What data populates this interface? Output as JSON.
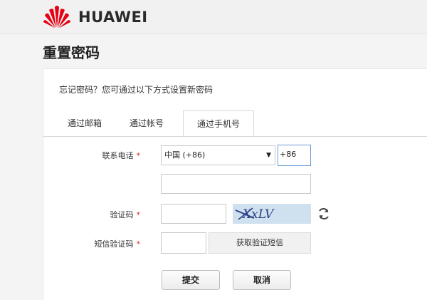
{
  "header": {
    "brand": "HUAWEI",
    "logo_color": "#e60012"
  },
  "page_title": "重置密码",
  "subtitle": "忘记密码？您可通过以下方式设置新密码",
  "tabs": [
    {
      "label": "通过邮箱",
      "active": false
    },
    {
      "label": "通过帐号",
      "active": false
    },
    {
      "label": "通过手机号",
      "active": true
    }
  ],
  "form": {
    "phone_label": "联系电话",
    "required_mark": "*",
    "country_select": {
      "value": "中国 (+86)",
      "caret": "▼"
    },
    "prefix_value": "+86",
    "phone_value": "",
    "captcha_label": "验证码",
    "captcha_value": "",
    "captcha_text": "XxLV",
    "sms_label": "短信验证码",
    "sms_value": "",
    "get_sms_button": "获取验证短信"
  },
  "actions": {
    "submit": "提交",
    "cancel": "取消"
  },
  "colors": {
    "accent": "#e60012",
    "captcha_bg": "#cfe0ee",
    "captcha_text": "#2b3f86"
  }
}
